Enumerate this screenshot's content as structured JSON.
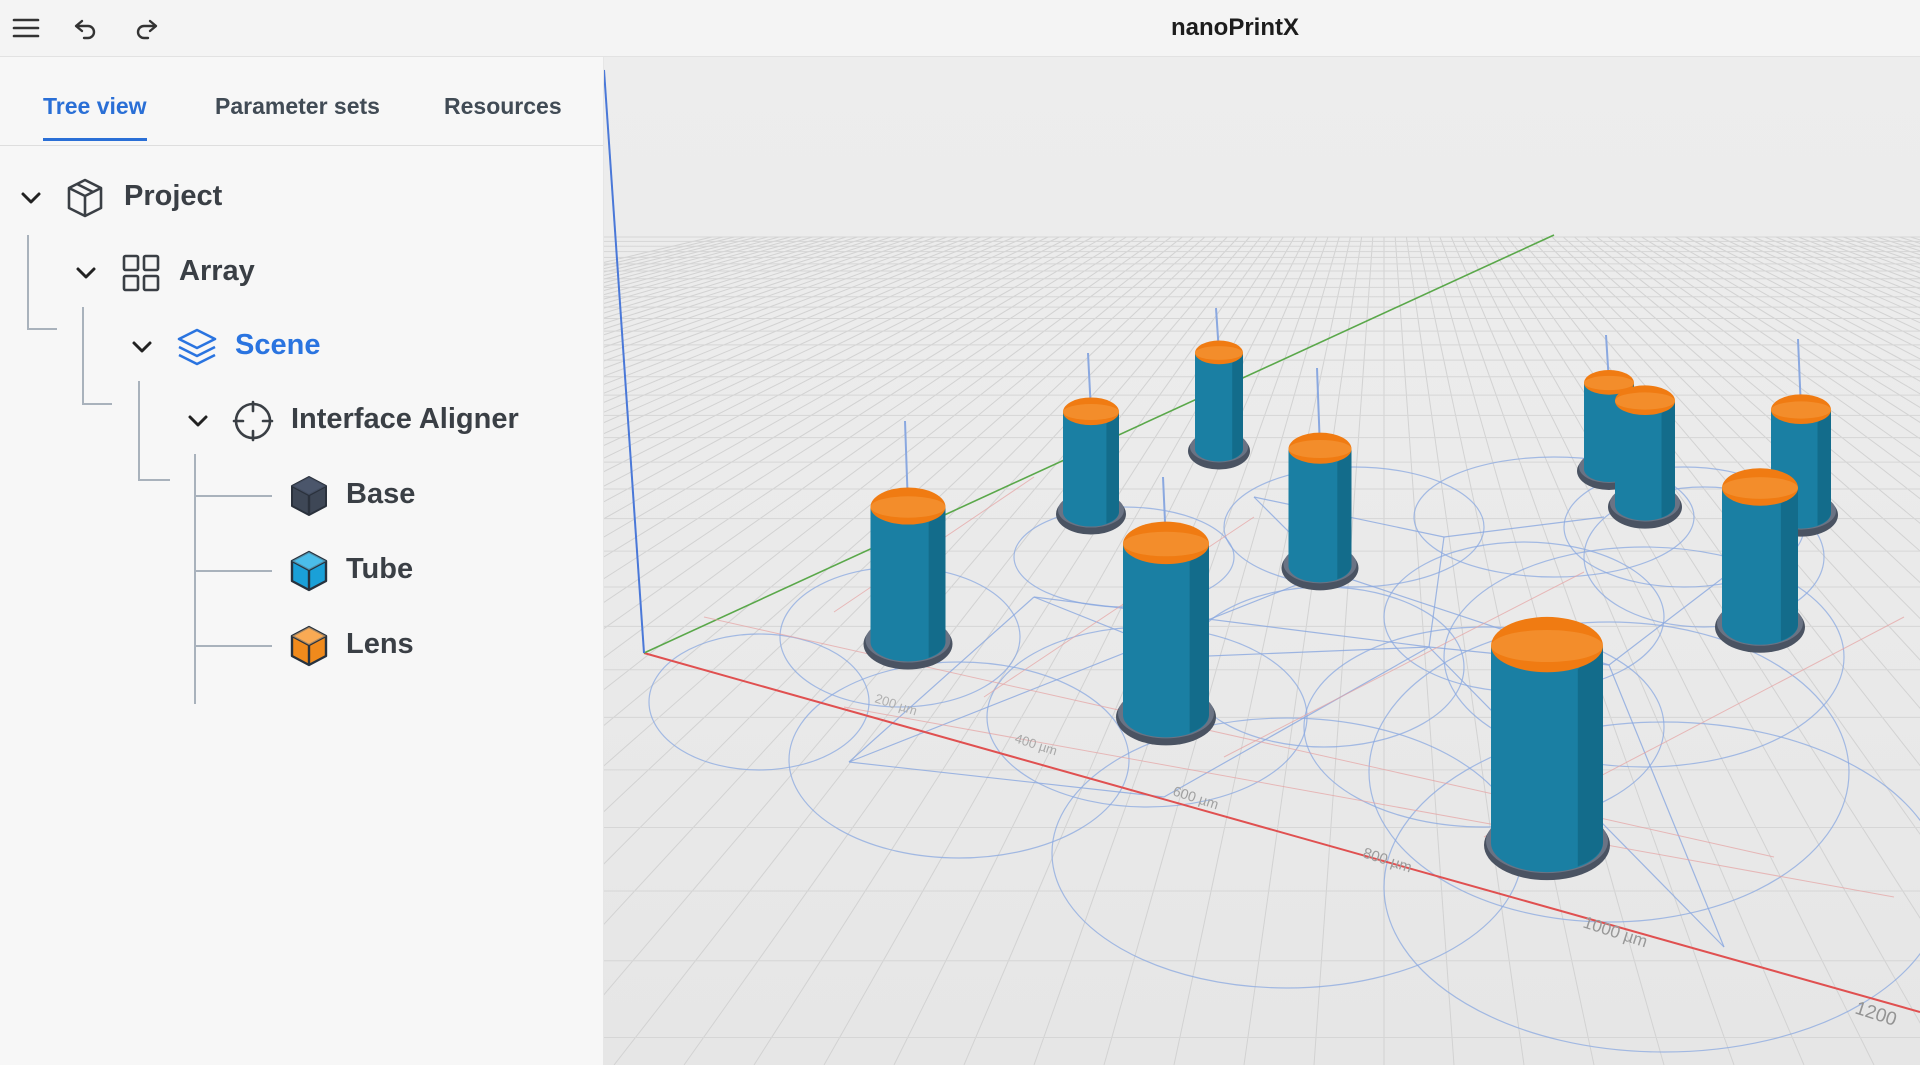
{
  "app": {
    "title": "nanoPrintX"
  },
  "toolbar": {
    "menu_icon": "hamburger-menu-icon",
    "undo_icon": "undo-icon",
    "redo_icon": "redo-icon"
  },
  "tabs": [
    {
      "label": "Tree view",
      "active": true
    },
    {
      "label": "Parameter sets",
      "active": false
    },
    {
      "label": "Resources",
      "active": false
    }
  ],
  "tree": {
    "project": {
      "label": "Project",
      "icon": "package-icon"
    },
    "array": {
      "label": "Array",
      "icon": "grid-icon"
    },
    "scene": {
      "label": "Scene",
      "icon": "layers-icon",
      "selected": true
    },
    "aligner": {
      "label": "Interface Aligner",
      "icon": "crosshair-icon"
    },
    "base": {
      "label": "Base",
      "icon": "cube-icon",
      "color": "#3e4756"
    },
    "tube": {
      "label": "Tube",
      "icon": "cube-icon",
      "color": "#1aa0d8"
    },
    "lens": {
      "label": "Lens",
      "icon": "cube-icon",
      "color": "#f08a1c"
    }
  },
  "viewport": {
    "axis_labels": [
      "200 µm",
      "400 µm",
      "600 µm",
      "800 µm",
      "1000 µm",
      "1200"
    ],
    "colors": {
      "tube_body": "#1a7fa3",
      "tube_dark": "#0f5c78",
      "lens_cap": "#f07b12",
      "base": "#4a5362",
      "x_axis": "#e05050",
      "y_axis": "#5aa84a",
      "z_axis": "#4a78d8",
      "circles": "#8aa8e0"
    }
  }
}
